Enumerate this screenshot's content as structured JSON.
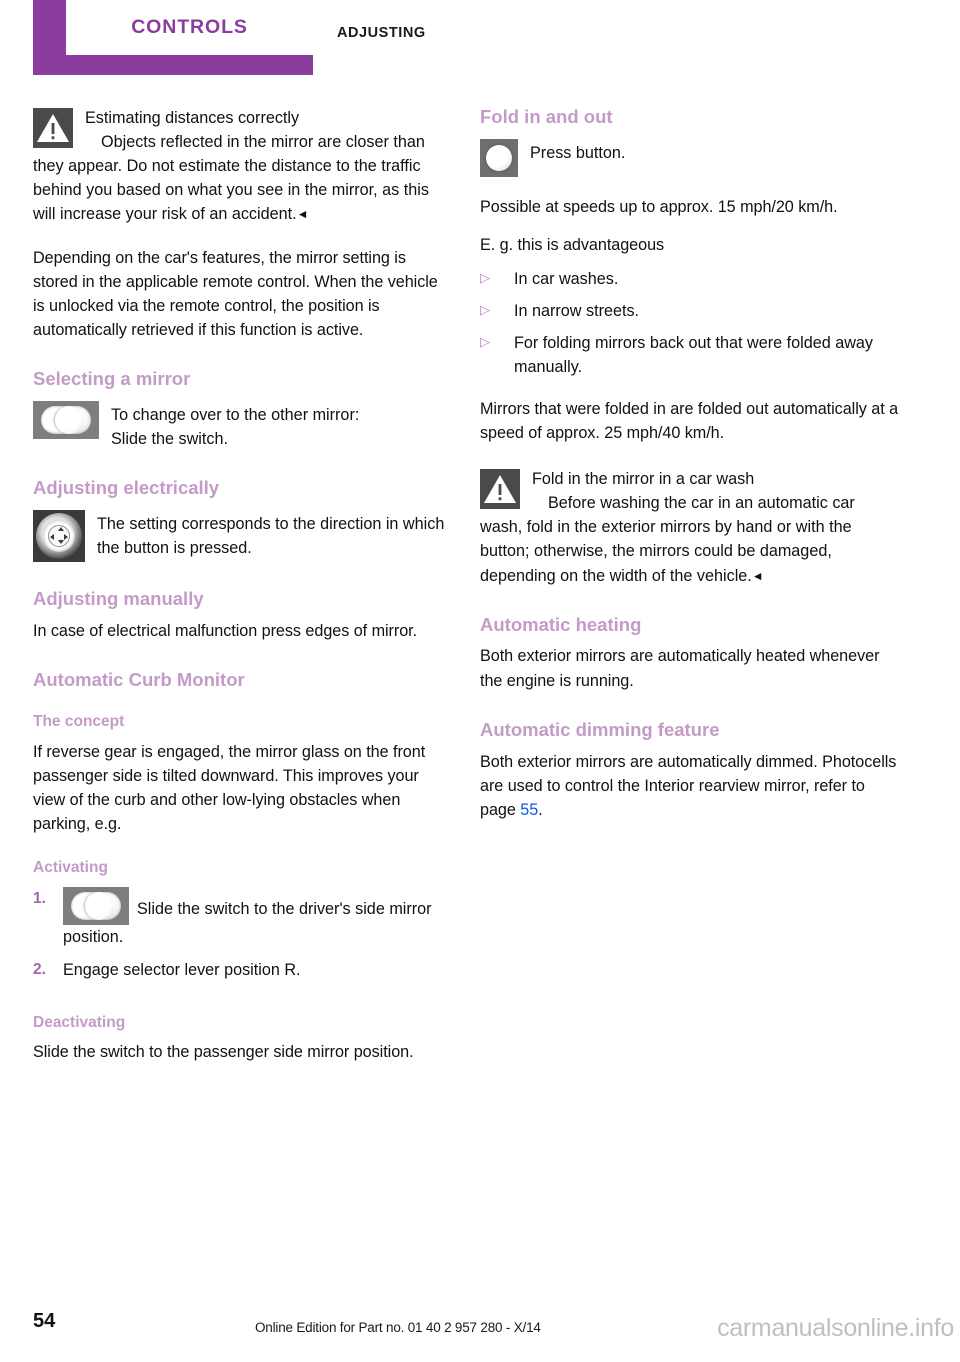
{
  "header": {
    "chapter": "CONTROLS",
    "section": "ADJUSTING",
    "chapter_color": "#8B3D9E"
  },
  "theme": {
    "heading_color": "#C49BC8",
    "bullet_color": "#B882C0",
    "number_color": "#A663B3",
    "link_color": "#1155EE",
    "body_color": "#111111",
    "watermark_color": "#BFBFBF"
  },
  "left_column": {
    "warning_1": {
      "icon": "warning-triangle-icon",
      "title": "Estimating distances correctly",
      "body": "Objects reflected in the mirror are closer than they appear. Do not estimate the distance to the traffic behind you based on what you see in the mirror, as this will increase your risk of an accident.",
      "endmark": "◄"
    },
    "paragraph_1": "Depending on the car's features, the mirror setting is stored in the applicable remote control. When the vehicle is unlocked via the remote control, the position is automatically retrieved if this function is active.",
    "selecting_mirror": {
      "heading": "Selecting a mirror",
      "icon": "mirror-switch-icon",
      "line_1": "To change over to the other mirror:",
      "line_2": "Slide the switch."
    },
    "adjusting_electrically": {
      "heading": "Adjusting electrically",
      "icon": "joystick-button-icon",
      "text": "The setting corresponds to the direction in which the button is pressed."
    },
    "adjusting_manually": {
      "heading": "Adjusting manually",
      "text": "In case of electrical malfunction press edges of mirror."
    },
    "curb_monitor": {
      "heading": "Automatic Curb Monitor",
      "concept_heading": "The concept",
      "concept_text": "If reverse gear is engaged, the mirror glass on the front passenger side is tilted downward. This improves your view of the curb and other low-lying obstacles when parking, e.g.",
      "activating_heading": "Activating",
      "steps": [
        {
          "number": "1.",
          "icon": "mirror-switch-icon",
          "text": "Slide the switch to the driver's side mirror position."
        },
        {
          "number": "2.",
          "icon": "",
          "text": "Engage selector lever position R."
        }
      ],
      "deactivating_heading": "Deactivating",
      "deactivating_text": "Slide the switch to the passenger side mirror position."
    }
  },
  "right_column": {
    "fold_in_out": {
      "heading": "Fold in and out",
      "icon": "press-button-icon",
      "icon_text": "Press button.",
      "paragraph_1": "Possible at speeds up to approx. 15 mph/20 km/h.",
      "paragraph_2": "E. g. this is advantageous",
      "bullets": [
        "In car washes.",
        "In narrow streets.",
        "For folding mirrors back out that were folded away manually."
      ],
      "bullet_glyph": "▷",
      "paragraph_3": "Mirrors that were folded in are folded out automatically at a speed of approx. 25 mph/40 km/h."
    },
    "warning_2": {
      "icon": "warning-triangle-icon",
      "title": "Fold in the mirror in a car wash",
      "body": "Before washing the car in an automatic car wash, fold in the exterior mirrors by hand or with the button; otherwise, the mirrors could be damaged, depending on the width of the vehicle.",
      "endmark": "◄"
    },
    "automatic_heating": {
      "heading": "Automatic heating",
      "text": "Both exterior mirrors are automatically heated whenever the engine is running."
    },
    "automatic_dimming": {
      "heading": "Automatic dimming feature",
      "text_before": "Both exterior mirrors are automatically dimmed. Photocells are used to control the Interior rearview mirror, refer to page ",
      "page_ref": "55",
      "text_after": "."
    }
  },
  "footer": {
    "page_number": "54",
    "edition": "Online Edition for Part no. 01 40 2 957 280 - X/14",
    "watermark": "carmanualsonline.info"
  }
}
